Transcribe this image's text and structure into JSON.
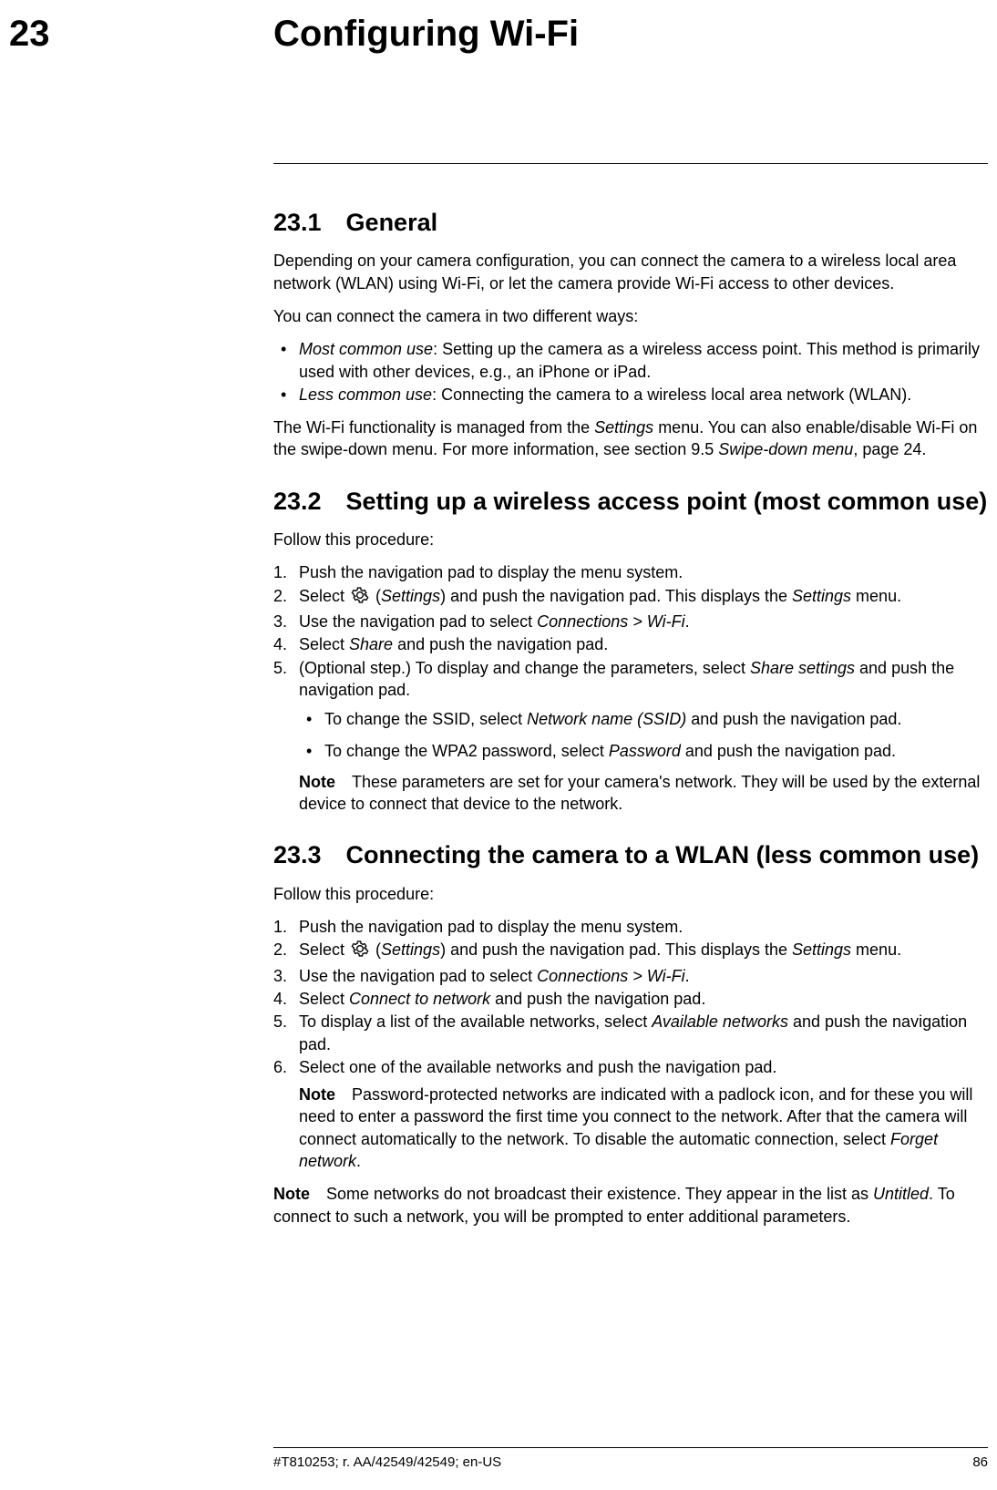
{
  "chapter": {
    "number": "23",
    "title": "Configuring Wi-Fi"
  },
  "sections": {
    "s1": {
      "heading": "23.1 General",
      "p1": "Depending on your camera configuration, you can connect the camera to a wireless local area network (WLAN) using Wi-Fi, or let the camera provide Wi-Fi access to other devices.",
      "p2": "You can connect the camera in two different ways:",
      "bullets": {
        "b1_em": "Most common use",
        "b1_rest": ": Setting up the camera as a wireless access point. This method is primarily used with other devices, e.g., an iPhone or iPad.",
        "b2_em": "Less common use",
        "b2_rest": ": Connecting the camera to a wireless local area network (WLAN)."
      },
      "p3_a": "The Wi-Fi functionality is managed from the ",
      "p3_em1": "Settings",
      "p3_b": " menu. You can also enable/disable Wi-Fi on the swipe-down menu. For more information, see section 9.5 ",
      "p3_em2": "Swipe-down menu",
      "p3_c": ", page 24."
    },
    "s2": {
      "heading": "23.2 Setting up a wireless access point (most common use)",
      "p1": "Follow this procedure:",
      "steps": {
        "st1": "Push the navigation pad to display the menu system.",
        "st2_a": "Select ",
        "st2_em1": "Settings",
        "st2_b": ") and push the navigation pad. This displays the ",
        "st2_em2": "Settings",
        "st2_c": " menu.",
        "st3_a": "Use the navigation pad to select ",
        "st3_em": "Connections > Wi-Fi",
        "st3_b": ".",
        "st4_a": "Select ",
        "st4_em": "Share",
        "st4_b": " and push the navigation pad.",
        "st5_a": "(Optional step.) To display and change the parameters, select ",
        "st5_em": "Share settings",
        "st5_b": " and push the navigation pad.",
        "sub": {
          "sb1_a": "To change the SSID, select ",
          "sb1_em": "Network name (SSID)",
          "sb1_b": " and push the navigation pad.",
          "sb2_a": "To change the WPA2 password, select ",
          "sb2_em": "Password",
          "sb2_b": " and push the navigation pad."
        },
        "note_label": "Note",
        "note_text": " These parameters are set for your camera's network. They will be used by the external device to connect that device to the network."
      }
    },
    "s3": {
      "heading": "23.3 Connecting the camera to a WLAN (less common use)",
      "p1": "Follow this procedure:",
      "steps": {
        "st1": "Push the navigation pad to display the menu system.",
        "st2_a": "Select ",
        "st2_em1": "Settings",
        "st2_b": ") and push the navigation pad. This displays the ",
        "st2_em2": "Settings",
        "st2_c": " menu.",
        "st3_a": "Use the navigation pad to select ",
        "st3_em": "Connections > Wi-Fi",
        "st3_b": ".",
        "st4_a": "Select ",
        "st4_em": "Connect to network",
        "st4_b": " and push the navigation pad.",
        "st5_a": "To display a list of the available networks, select ",
        "st5_em": "Available networks",
        "st5_b": " and push the navigation pad.",
        "st6": "Select one of the available networks and push the navigation pad.",
        "note_label": "Note",
        "note_a": " Password-protected networks are indicated with a padlock icon, and for these you will need to enter a password the first time you connect to the network. After that the camera will connect automatically to the network. To disable the automatic connection, select ",
        "note_em": "Forget network",
        "note_b": "."
      },
      "outer_note_label": "Note",
      "outer_note_a": " Some networks do not broadcast their existence. They appear in the list as ",
      "outer_note_em": "Untitled",
      "outer_note_b": ". To connect to such a network, you will be prompted to enter additional parameters."
    }
  },
  "footer": {
    "docid": "#T810253; r. AA/42549/42549; en-US",
    "page": "86"
  }
}
